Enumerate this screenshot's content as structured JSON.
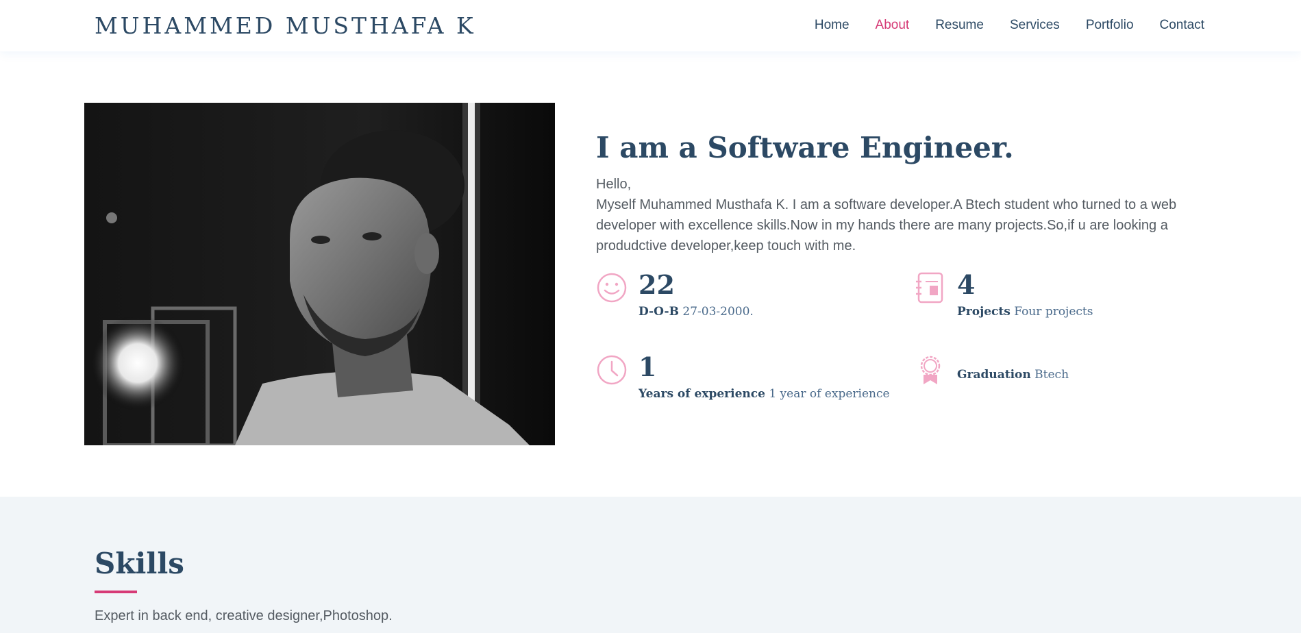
{
  "header": {
    "logo": "MUHAMMED MUSTHAFA K",
    "nav": [
      {
        "label": "Home",
        "active": false
      },
      {
        "label": "About",
        "active": true
      },
      {
        "label": "Resume",
        "active": false
      },
      {
        "label": "Services",
        "active": false
      },
      {
        "label": "Portfolio",
        "active": false
      },
      {
        "label": "Contact",
        "active": false
      }
    ]
  },
  "about": {
    "headline": "I am a Software Engineer.",
    "greeting": "Hello,",
    "intro": "Myself Muhammed Musthafa K. I am a software developer.A Btech student who turned to a web developer with excellence skills.Now in my hands there are many projects.So,if u are looking a produdctive developer,keep touch with me.",
    "stats": [
      {
        "icon": "smile-icon",
        "number": "22",
        "label_bold": "D-O-B",
        "label_text": "27-03-2000."
      },
      {
        "icon": "journal-icon",
        "number": "4",
        "label_bold": "Projects",
        "label_text": "Four projects"
      },
      {
        "icon": "clock-icon",
        "number": "1",
        "label_bold": "Years of experience",
        "label_text": "1 year of experience"
      },
      {
        "icon": "award-icon",
        "number": "",
        "label_bold": "Graduation",
        "label_text": "Btech"
      }
    ]
  },
  "skills": {
    "title": "Skills",
    "description": "Expert in back end, creative designer,Photoshop."
  },
  "colors": {
    "primary": "#2c4964",
    "accent": "#d63a76",
    "icon": "#f1a6c4",
    "section_bg": "#f1f5f8"
  }
}
